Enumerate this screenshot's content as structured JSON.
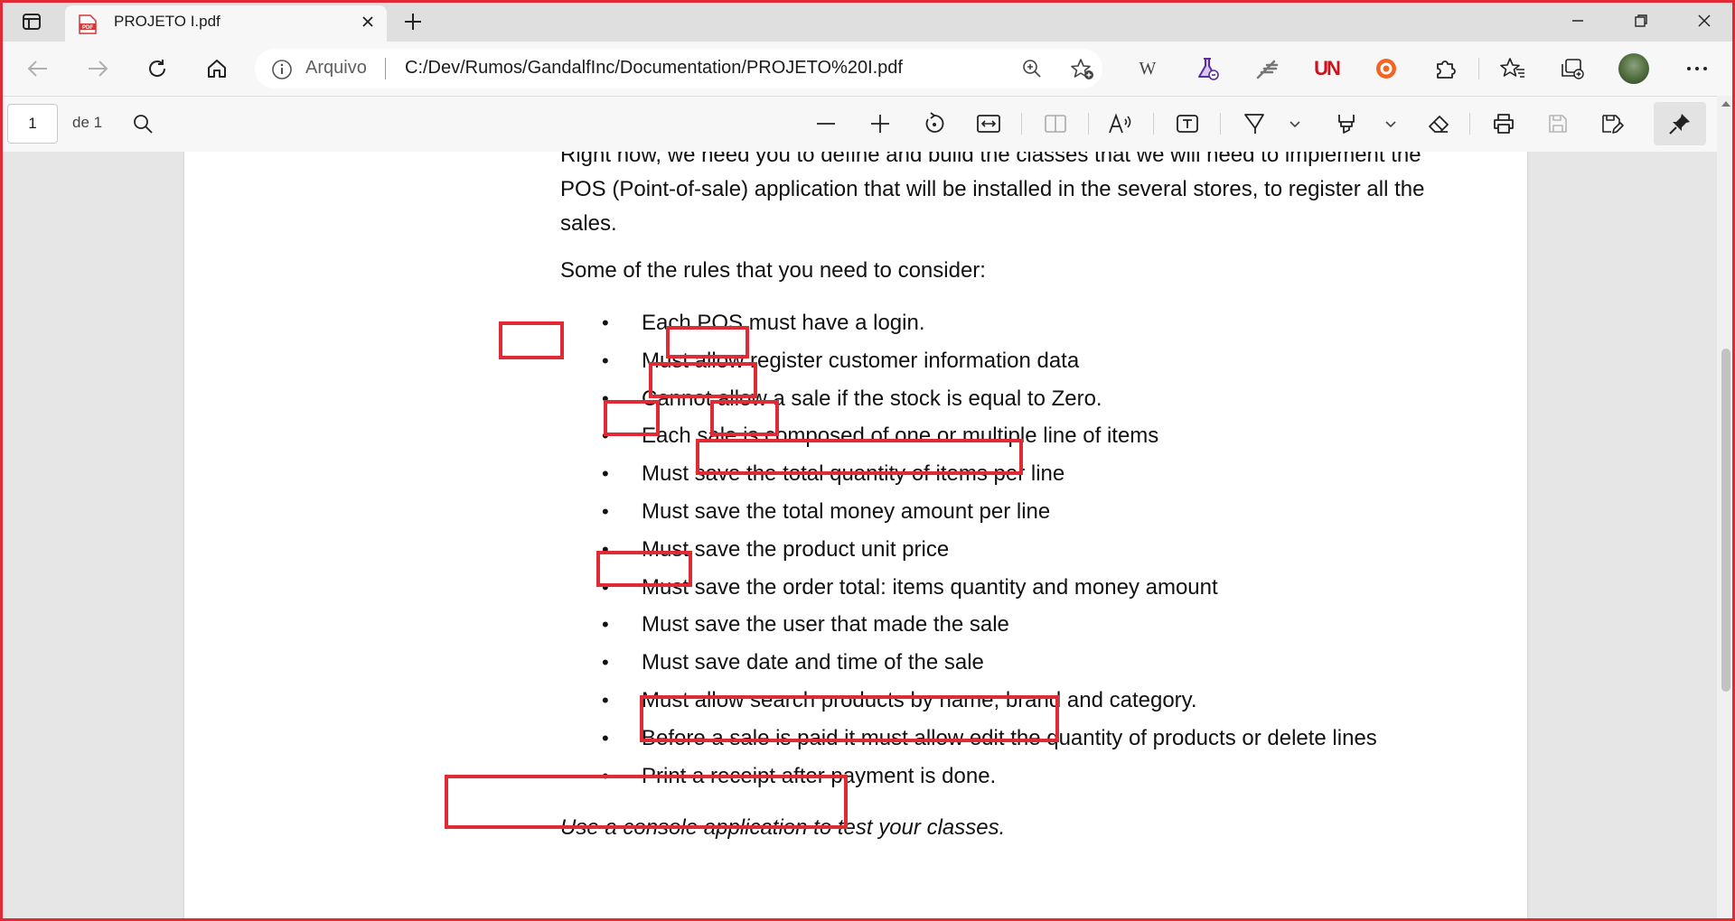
{
  "browser": {
    "tab": {
      "title": "PROJETO I.pdf",
      "favicon_label": "PDF"
    },
    "address": {
      "scheme_label": "Arquivo",
      "url": "C:/Dev/Rumos/GandalfInc/Documentation/PROJETO%20I.pdf"
    },
    "extensions": [
      "wikipedia-w-icon",
      "flask-icon",
      "feather-icon",
      "un-logo-icon",
      "orange-circle-icon",
      "puzzle-icon"
    ],
    "ext_text": {
      "wiki": "W",
      "un": "UN"
    },
    "colors": {
      "accent_red": "#e02a34",
      "tab_bg": "#f7f7f7",
      "strip_bg": "#dfdfdf"
    }
  },
  "pdf_toolbar": {
    "page_value": "1",
    "page_of": "de 1"
  },
  "document": {
    "intro": "Right now, we need you to define and build the classes that we will need to implement the POS (Point-of-sale) application that will be installed in the several stores, to register all the sales.",
    "rules_intro": "Some of the rules that you need to consider:",
    "rules": [
      "Each POS must have a login.",
      "Must allow register customer information data",
      "Cannot allow a sale if the stock is equal to Zero.",
      "Each sale is composed of one or multiple line of items",
      "Must save the total quantity of items per line",
      "Must save the total money amount per line",
      "Must save the product unit price",
      "Must save the order total: items quantity and money amount",
      "Must save the user that made the sale",
      "Must save date and time of the sale",
      "Must allow search products by name, brand and category.",
      "Before a sale is paid it must allow edit the quantity of products or delete lines",
      "Print a receipt after payment is done."
    ],
    "outro": "Use a console application to test your classes.",
    "bullet": "•"
  }
}
